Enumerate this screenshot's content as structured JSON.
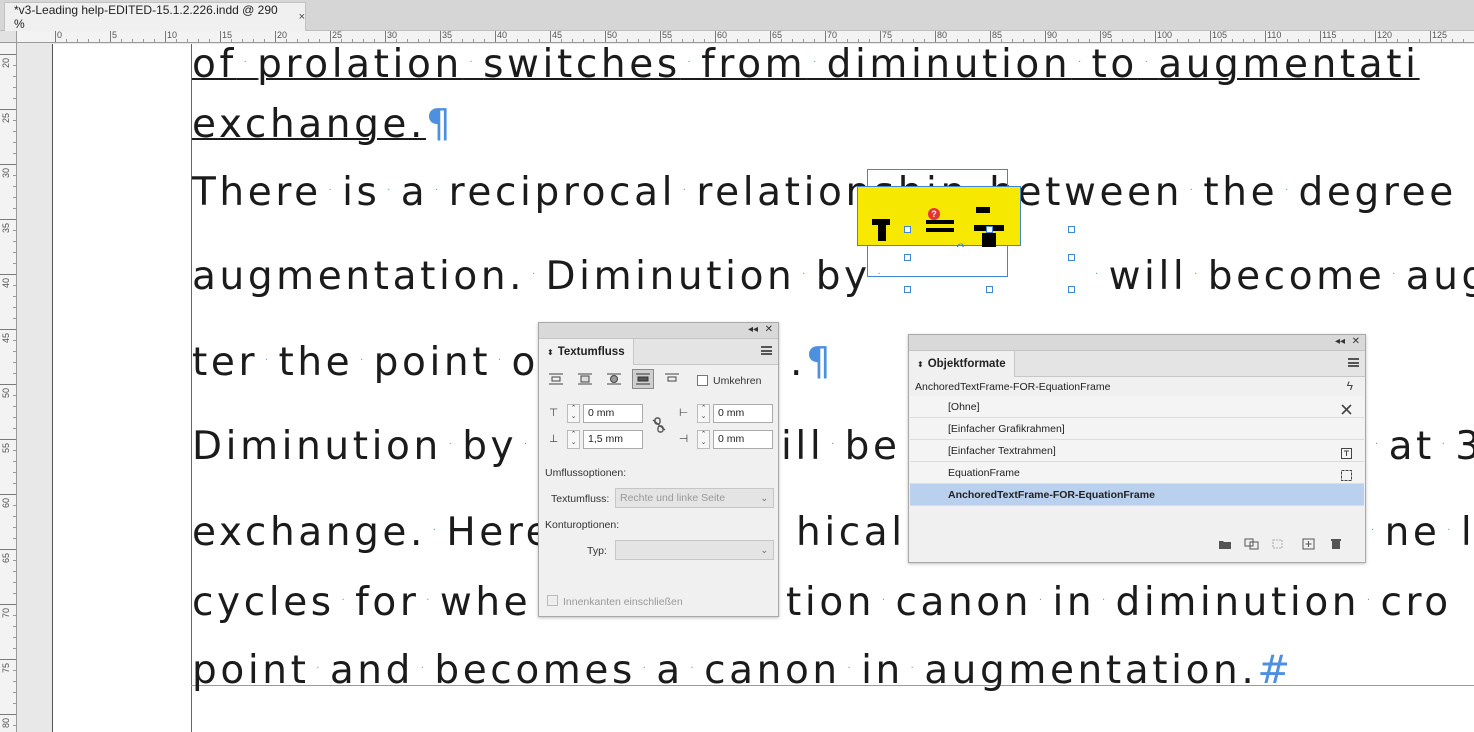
{
  "document_tab": {
    "title": "*v3-Leading help-EDITED-15.1.2.226.indd @ 290 %",
    "close": "×"
  },
  "ruler": {
    "top_labels": [
      "0",
      "5",
      "10",
      "15",
      "20",
      "25",
      "30",
      "35",
      "40",
      "45",
      "50",
      "55",
      "60",
      "65",
      "70",
      "75",
      "80",
      "85",
      "90",
      "95",
      "100",
      "105",
      "110",
      "115",
      "120",
      "125"
    ],
    "left_labels": [
      "20",
      "25",
      "30",
      "35",
      "40",
      "45",
      "50",
      "55",
      "60",
      "65",
      "70",
      "75",
      "80"
    ]
  },
  "text": {
    "line1_words": [
      "of",
      "prolation",
      "switches",
      "from",
      "diminution",
      "to",
      "augmentati"
    ],
    "line2_words": [
      "exchange."
    ],
    "line3_words": [
      "There",
      "is",
      "a",
      "reciprocal",
      "relationship",
      "between",
      "the",
      "degree"
    ],
    "line4_pre": [
      "augmentation.",
      "Diminution",
      "by"
    ],
    "line4_post": [
      "will",
      "become",
      "aug"
    ],
    "line5_words": [
      "ter",
      "the",
      "point",
      "o"
    ],
    "line5_end": ".",
    "line6_pre": [
      "Diminution",
      "by"
    ],
    "line6_mid": [
      "ill",
      "be"
    ],
    "line6_post": [
      "at",
      "3"
    ],
    "line7_pre": [
      "exchange.",
      "Here"
    ],
    "line7_mid": [
      "hical"
    ],
    "line7_post": [
      "ne",
      "le"
    ],
    "line8_pre": [
      "cycles",
      "for",
      "whe"
    ],
    "line8_mid": [
      "tion",
      "canon",
      "in",
      "diminution",
      "cro"
    ],
    "line9_words": [
      "point",
      "and",
      "becomes",
      "a",
      "canon",
      "in",
      "augmentation."
    ],
    "pilcrow": "¶",
    "end_of_story": "#"
  },
  "anchored_frame": {
    "error_badge": "?"
  },
  "textumfluss_panel": {
    "title": "Textumfluss",
    "invert_label": "Umkehren",
    "offset_top": "0 mm",
    "offset_bottom": "1,5 mm",
    "offset_left": "0 mm",
    "offset_right": "0 mm",
    "wrap_options_heading": "Umflussoptionen:",
    "wrap_to_label": "Textumfluss:",
    "wrap_to_value": "Rechte und linke Seite",
    "contour_heading": "Konturoptionen:",
    "type_label": "Typ:",
    "type_value": "",
    "inner_edges_label": "Innenkanten einschließen"
  },
  "objektformate_panel": {
    "title": "Objektformate",
    "current_style": "AnchoredTextFrame-FOR-EquationFrame",
    "items": [
      {
        "label": "[Ohne]",
        "icon": "no-edit-icon"
      },
      {
        "label": "[Einfacher Grafikrahmen]",
        "icon": ""
      },
      {
        "label": "[Einfacher Textrahmen]",
        "icon": "text-frame-default-icon"
      },
      {
        "label": "EquationFrame",
        "icon": "graphic-frame-default-icon"
      },
      {
        "label": "AnchoredTextFrame-FOR-EquationFrame",
        "icon": ""
      }
    ],
    "selected_index": 4
  }
}
